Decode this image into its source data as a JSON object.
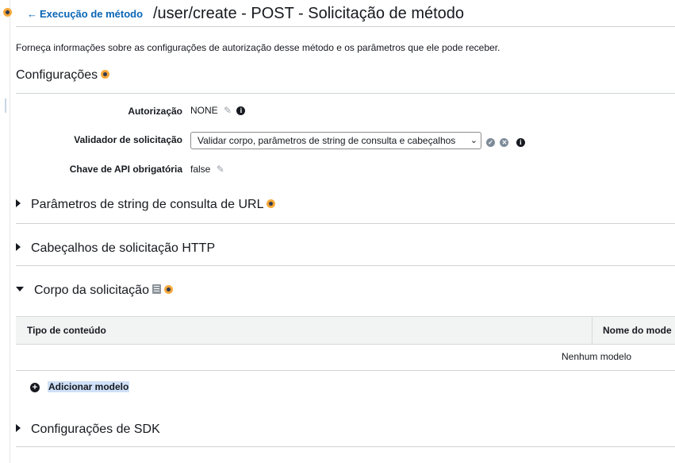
{
  "nav": {
    "back_link": "Execução de método"
  },
  "page": {
    "title": "/user/create - POST - Solicitação de método",
    "description": "Forneça informações sobre as configurações de autorização desse método e os parâmetros que ele pode receber."
  },
  "settings": {
    "heading": "Configurações",
    "authorization_label": "Autorização",
    "authorization_value": "NONE",
    "validator_label": "Validador de solicitação",
    "validator_selected": "Validar corpo, parâmetros de string de consulta e cabeçalhos",
    "api_key_label": "Chave de API obrigatória",
    "api_key_value": "false"
  },
  "sections": {
    "query_params": "Parâmetros de string de consulta de URL",
    "http_headers": "Cabeçalhos de solicitação HTTP",
    "request_body": "Corpo da solicitação",
    "sdk_settings": "Configurações de SDK"
  },
  "body_table": {
    "columns": [
      "Tipo de conteúdo",
      "Nome do mode"
    ],
    "empty_text": "Nenhum modelo",
    "add_label": "Adicionar modelo"
  },
  "colors": {
    "link": "#0a66b5",
    "dot_outer": "#f7a93a",
    "dot_inner": "#2f3a52",
    "table_header_bg": "#f2f3f3",
    "highlight": "#cfe0f7"
  },
  "icons": {
    "status_dot": "orange-status-dot-icon",
    "back": "arrow-left-icon",
    "edit": "pencil-icon",
    "info": "info-icon",
    "valid": "check-circle-icon",
    "cancel": "x-circle-icon",
    "expand": "caret-right-icon",
    "collapse": "caret-down-icon",
    "docs": "book-icon",
    "add": "plus-circle-icon"
  }
}
